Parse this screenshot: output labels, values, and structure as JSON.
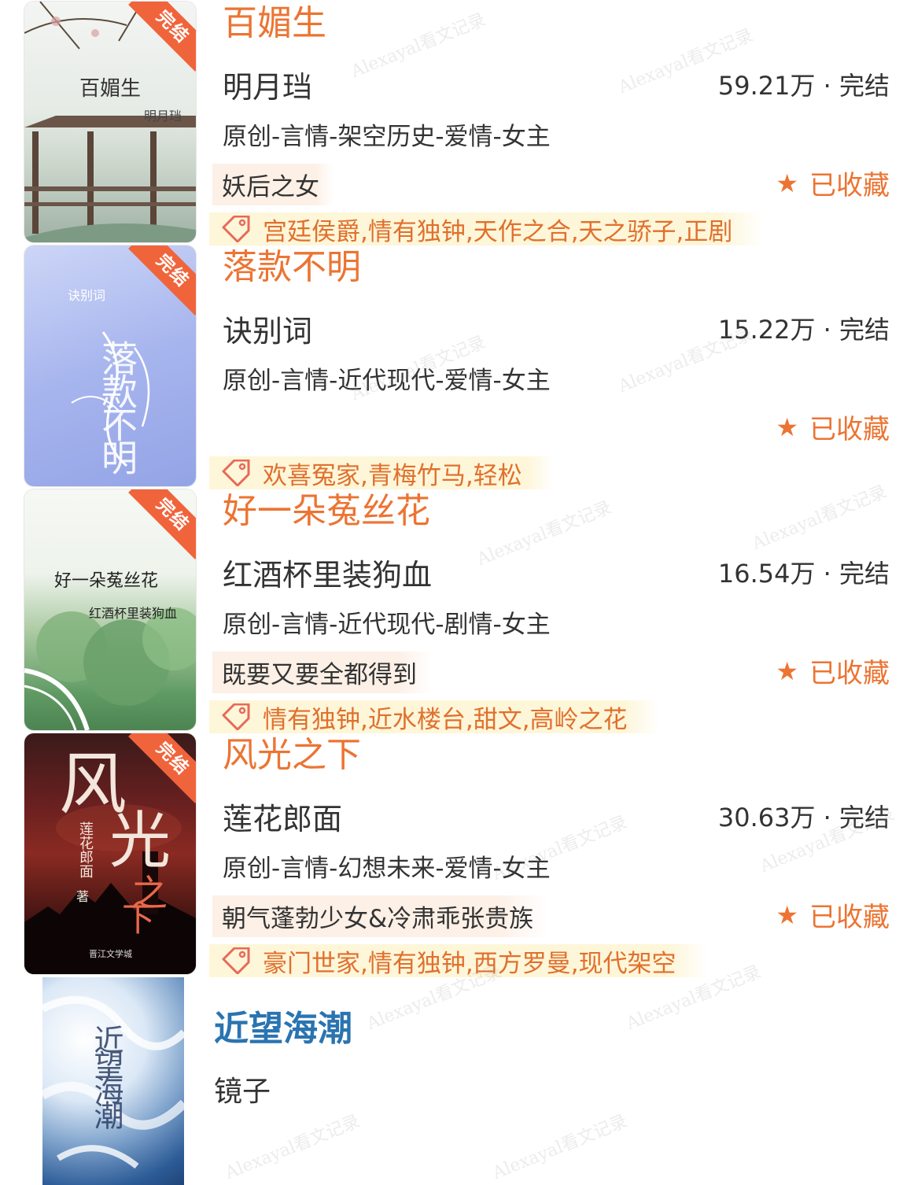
{
  "books": [
    {
      "title": "百媚生",
      "author": "明月珰",
      "stats": "59.21万 · 完结",
      "category": "原创-言情-架空历史-爱情-女主",
      "intro": "妖后之女",
      "favorite": "已收藏",
      "tags": "宫廷侯爵,情有独钟,天作之合,天之骄子,正剧",
      "badge": "完结",
      "cover_title": "百媚生",
      "cover_author": "明月珰"
    },
    {
      "title": "落款不明",
      "author": "诀别词",
      "stats": "15.22万 · 完结",
      "category": "原创-言情-近代现代-爱情-女主",
      "intro": "",
      "favorite": "已收藏",
      "tags": "欢喜冤家,青梅竹马,轻松",
      "badge": "完结",
      "cover_title": "落款不明",
      "cover_author": "诀别词"
    },
    {
      "title": "好一朵菟丝花",
      "author": "红酒杯里装狗血",
      "stats": "16.54万 · 完结",
      "category": "原创-言情-近代现代-剧情-女主",
      "intro": "既要又要全都得到",
      "favorite": "已收藏",
      "tags": "情有独钟,近水楼台,甜文,高岭之花",
      "badge": "完结",
      "cover_title": "好一朵菟丝花",
      "cover_author": "红酒杯里装狗血"
    },
    {
      "title": "风光之下",
      "author": "莲花郎面",
      "stats": "30.63万 · 完结",
      "category": "原创-言情-幻想未来-爱情-女主",
      "intro": "朝气蓬勃少女&冷肃乖张贵族",
      "favorite": "已收藏",
      "tags": "豪门世家,情有独钟,西方罗曼,现代架空",
      "badge": "完结",
      "cover_title": "风光之下",
      "cover_author": "莲花郎面",
      "cover_extra": "著",
      "cover_publisher": "晋江文学城"
    }
  ],
  "last_book": {
    "title": "近望海潮",
    "author": "镜子",
    "cover_title": "近望海潮"
  },
  "watermark": "Alexayal看文记录",
  "colors": {
    "accent": "#ec7432",
    "title_blue": "#2a74b0",
    "badge": "#f0643c",
    "tag_bg": "#fef6d8",
    "intro_bg": "#fdf0e6"
  }
}
